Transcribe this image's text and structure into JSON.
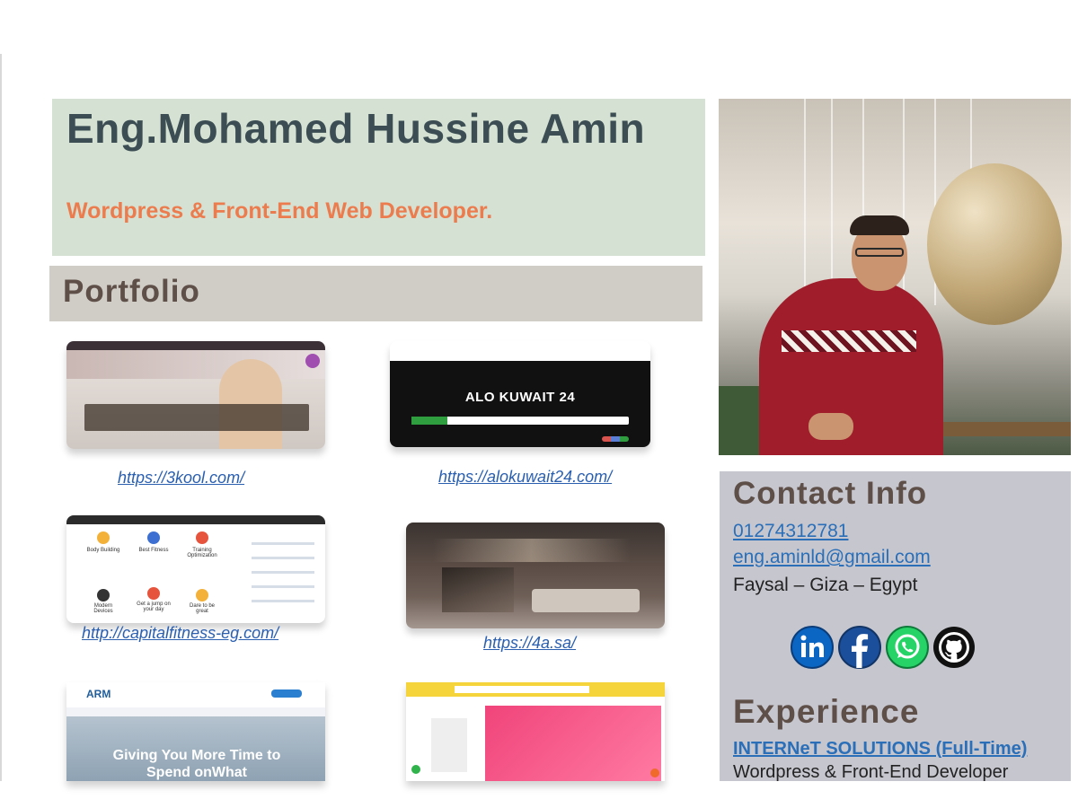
{
  "header": {
    "name": "Eng.Mohamed Hussine Amin",
    "role": "Wordpress & Front-End Web Developer."
  },
  "portfolio": {
    "title": "Portfolio",
    "items": [
      {
        "url": "https://3kool.com/"
      },
      {
        "url": "https://alokuwait24.com/",
        "preview_text": "ALO KUWAIT 24"
      },
      {
        "url": "http://capitalfitness-eg.com/",
        "preview_labels": [
          "Body Building",
          "Best Fitness",
          "Training Optimization",
          "Modern Devices",
          "Get a jump on your day",
          "Dare to be great"
        ]
      },
      {
        "url": "https://4a.sa/"
      },
      {
        "preview_text": "Giving You More Time to Spend onWhat",
        "preview_logo": "ARM"
      },
      {
        "preview_logo": ""
      }
    ]
  },
  "contact": {
    "title": "Contact Info",
    "phone": "01274312781",
    "email": "eng.aminld@gmail.com",
    "address": "Faysal – Giza – Egypt",
    "social": [
      {
        "name": "linkedin-icon",
        "color": "#0a66c2"
      },
      {
        "name": "facebook-icon",
        "color": "#1b4f9c"
      },
      {
        "name": "whatsapp-icon",
        "color": "#25d366"
      },
      {
        "name": "github-icon",
        "color": "#111111"
      }
    ]
  },
  "experience": {
    "title": "Experience",
    "company": "INTERNeT SOLUTIONS (Full-Time)",
    "role": "Wordpress & Front-End Developer"
  },
  "colors": {
    "header_bg": "#d4e1d3",
    "name": "#3c4e53",
    "accent_orange": "#ec7c4e",
    "section_bar": "#d0ccc6",
    "section_title": "#5e4f48",
    "link": "#2a5fb0",
    "contact_bg": "#c6c6cf"
  }
}
